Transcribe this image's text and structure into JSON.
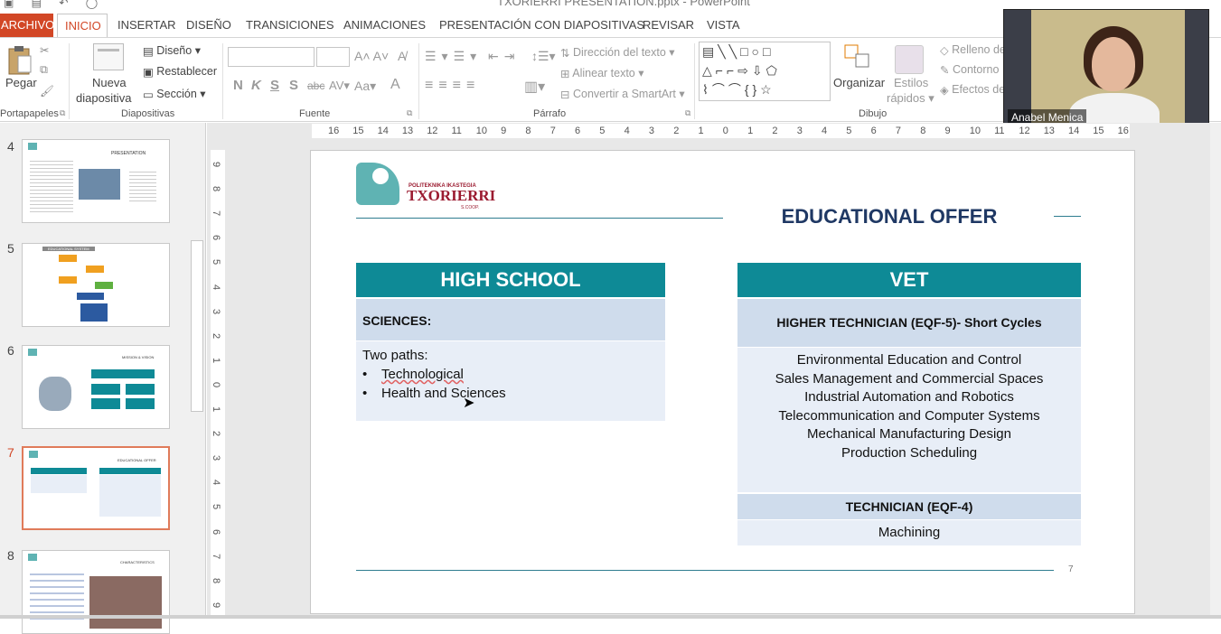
{
  "window": {
    "title": "TXORIERRI PRESENTATION.pptx - PowerPoint"
  },
  "tabs": [
    "ARCHIVO",
    "INICIO",
    "INSERTAR",
    "DISEÑO",
    "TRANSICIONES",
    "ANIMACIONES",
    "PRESENTACIÓN CON DIAPOSITIVAS",
    "REVISAR",
    "VISTA"
  ],
  "ribbon": {
    "portapapeles": {
      "label": "Portapapeles",
      "paste": "Pegar"
    },
    "diapositivas": {
      "label": "Diapositivas",
      "nueva1": "Nueva",
      "nueva2": "diapositiva",
      "diseno": "Diseño",
      "restablecer": "Restablecer",
      "seccion": "Sección"
    },
    "fuente": {
      "label": "Fuente",
      "n": "N",
      "k": "K",
      "s": "S",
      "s2": "S",
      "abc": "abc",
      "av": "AV",
      "aa": "Aa",
      "a": "A"
    },
    "parrafo": {
      "label": "Párrafo",
      "direccion": "Dirección del texto",
      "alinear": "Alinear texto",
      "convertir": "Convertir a SmartArt"
    },
    "dibujo": {
      "label": "Dibujo",
      "organizar": "Organizar",
      "estilos1": "Estilos",
      "estilos2": "rápidos",
      "relleno": "Relleno de",
      "contorno": "Contorno",
      "efectos": "Efectos de"
    }
  },
  "video": {
    "name": "Anabel Menica"
  },
  "thumbnails": [
    {
      "num": "4",
      "title": "PRESENTATION"
    },
    {
      "num": "5",
      "title": "EDUCATIONAL SYSTEM"
    },
    {
      "num": "6",
      "title": "MISSION & VISION"
    },
    {
      "num": "7",
      "title": "EDUCATIONAL OFFER"
    },
    {
      "num": "8",
      "title": "CHARACTERISTICS"
    }
  ],
  "ruler_h": [
    "16",
    "15",
    "14",
    "13",
    "12",
    "11",
    "10",
    "9",
    "8",
    "7",
    "6",
    "5",
    "4",
    "3",
    "2",
    "1",
    "0",
    "1",
    "2",
    "3",
    "4",
    "5",
    "6",
    "7",
    "8",
    "9",
    "10",
    "11",
    "12",
    "13",
    "14",
    "15",
    "16"
  ],
  "ruler_v": [
    "9",
    "8",
    "7",
    "6",
    "5",
    "4",
    "3",
    "2",
    "1",
    "0",
    "1",
    "2",
    "3",
    "4",
    "5",
    "6",
    "7",
    "8",
    "9"
  ],
  "slide": {
    "logo_small": "POLITEKNIKA IKASTEGIA",
    "logo_big": "TXORIERRI",
    "logo_coop": "S.COOP.",
    "title": "EDUCATIONAL OFFER",
    "high_school": {
      "head": "HIGH SCHOOL",
      "sciences": "SCIENCES:",
      "intro": "Two paths:",
      "items": [
        "Technological",
        "Health and Sciences"
      ]
    },
    "vet": {
      "head": "VET",
      "higher": "HIGHER TECHNICIAN (EQF-5)- Short Cycles",
      "courses": [
        "Environmental Education and Control",
        "Sales Management and Commercial Spaces",
        "Industrial Automation and Robotics",
        "Telecommunication and Computer Systems",
        "Mechanical Manufacturing Design",
        "Production Scheduling"
      ],
      "technician": "TECHNICIAN (EQF-4)",
      "machining": "Machining"
    },
    "page": "7"
  }
}
